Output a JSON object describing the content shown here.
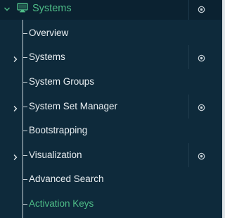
{
  "nav": {
    "section": {
      "label": "Systems",
      "icon": "monitor-icon",
      "expanded": true
    },
    "items": [
      {
        "label": "Overview",
        "expandable": false,
        "pin": false,
        "active": false
      },
      {
        "label": "Systems",
        "expandable": true,
        "pin": true,
        "active": false
      },
      {
        "label": "System Groups",
        "expandable": false,
        "pin": false,
        "active": false
      },
      {
        "label": "System Set Manager",
        "expandable": true,
        "pin": true,
        "active": false
      },
      {
        "label": "Bootstrapping",
        "expandable": false,
        "pin": false,
        "active": false
      },
      {
        "label": "Visualization",
        "expandable": true,
        "pin": true,
        "active": false
      },
      {
        "label": "Advanced Search",
        "expandable": false,
        "pin": false,
        "active": false
      },
      {
        "label": "Activation Keys",
        "expandable": false,
        "pin": false,
        "active": true
      }
    ]
  },
  "colors": {
    "background": "#0e2a3b",
    "active": "#4ebc87",
    "text": "#e8edf0"
  }
}
